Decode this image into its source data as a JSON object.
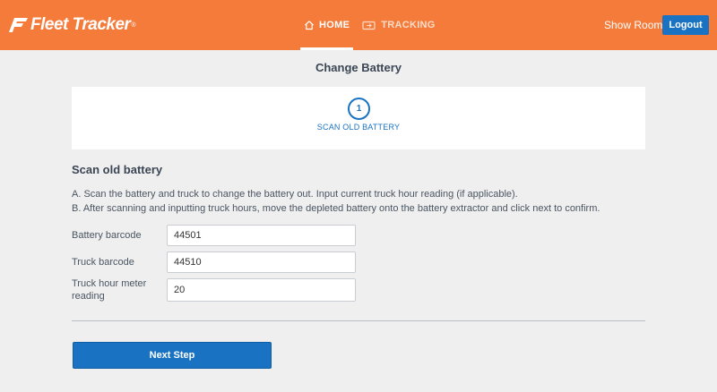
{
  "header": {
    "logo_text": "Fleet Tracker",
    "logo_tm": "®",
    "nav": {
      "home": {
        "label": "HOME",
        "icon": "home-icon"
      },
      "tracking": {
        "label": "TRACKING",
        "icon": "truck-icon"
      }
    },
    "user_label": "Show Room",
    "logout_label": "Logout"
  },
  "page_title": "Change Battery",
  "stepper": {
    "step_number": "1",
    "step_label": "SCAN OLD BATTERY"
  },
  "section": {
    "title": "Scan old battery",
    "instruction_a": "A. Scan the battery and truck to change the battery out. Input current truck hour reading (if applicable).",
    "instruction_b": "B. After scanning and inputting truck hours, move the depleted battery onto the battery extractor and click next to confirm."
  },
  "form": {
    "battery_barcode": {
      "label": "Battery barcode",
      "value": "44501"
    },
    "truck_barcode": {
      "label": "Truck barcode",
      "value": "44510"
    },
    "truck_hours": {
      "label_line1": "Truck hour meter",
      "label_line2": "reading",
      "value": "20"
    }
  },
  "next_button_label": "Next Step",
  "colors": {
    "header": "#f47b3a",
    "accent": "#1a73c2",
    "background": "#efefef"
  }
}
